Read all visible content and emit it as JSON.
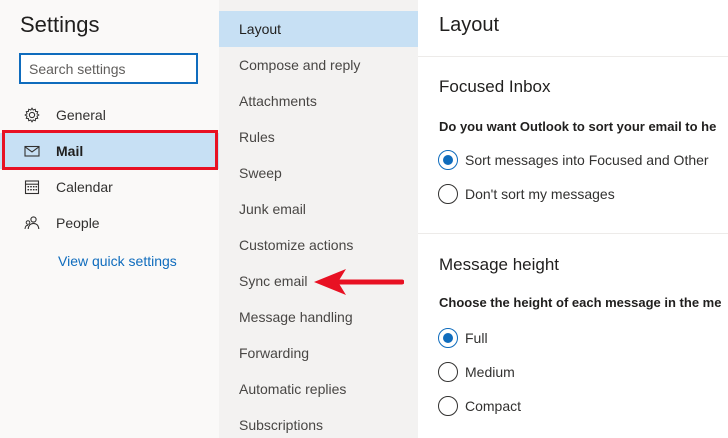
{
  "settings": {
    "title": "Settings",
    "search_placeholder": "Search settings",
    "nav": [
      {
        "label": "General",
        "icon": "gear-icon"
      },
      {
        "label": "Mail",
        "icon": "mail-icon",
        "selected": true
      },
      {
        "label": "Calendar",
        "icon": "calendar-icon"
      },
      {
        "label": "People",
        "icon": "people-icon"
      }
    ],
    "quick_settings_link": "View quick settings"
  },
  "categories": [
    {
      "label": "Layout",
      "selected": true
    },
    {
      "label": "Compose and reply"
    },
    {
      "label": "Attachments"
    },
    {
      "label": "Rules"
    },
    {
      "label": "Sweep"
    },
    {
      "label": "Junk email"
    },
    {
      "label": "Customize actions"
    },
    {
      "label": "Sync email"
    },
    {
      "label": "Message handling"
    },
    {
      "label": "Forwarding"
    },
    {
      "label": "Automatic replies"
    },
    {
      "label": "Subscriptions"
    }
  ],
  "content": {
    "title": "Layout",
    "focused_inbox": {
      "title": "Focused Inbox",
      "question": "Do you want Outlook to sort your email to he",
      "options": [
        {
          "label": "Sort messages into Focused and Other",
          "checked": true
        },
        {
          "label": "Don't sort my messages",
          "checked": false
        }
      ]
    },
    "message_height": {
      "title": "Message height",
      "question": "Choose the height of each message in the me",
      "options": [
        {
          "label": "Full",
          "checked": true
        },
        {
          "label": "Medium",
          "checked": false
        },
        {
          "label": "Compact",
          "checked": false
        }
      ]
    }
  },
  "colors": {
    "accent": "#0f6cbd",
    "selected_bg": "#c7e0f4",
    "annotation_red": "#e81123"
  }
}
